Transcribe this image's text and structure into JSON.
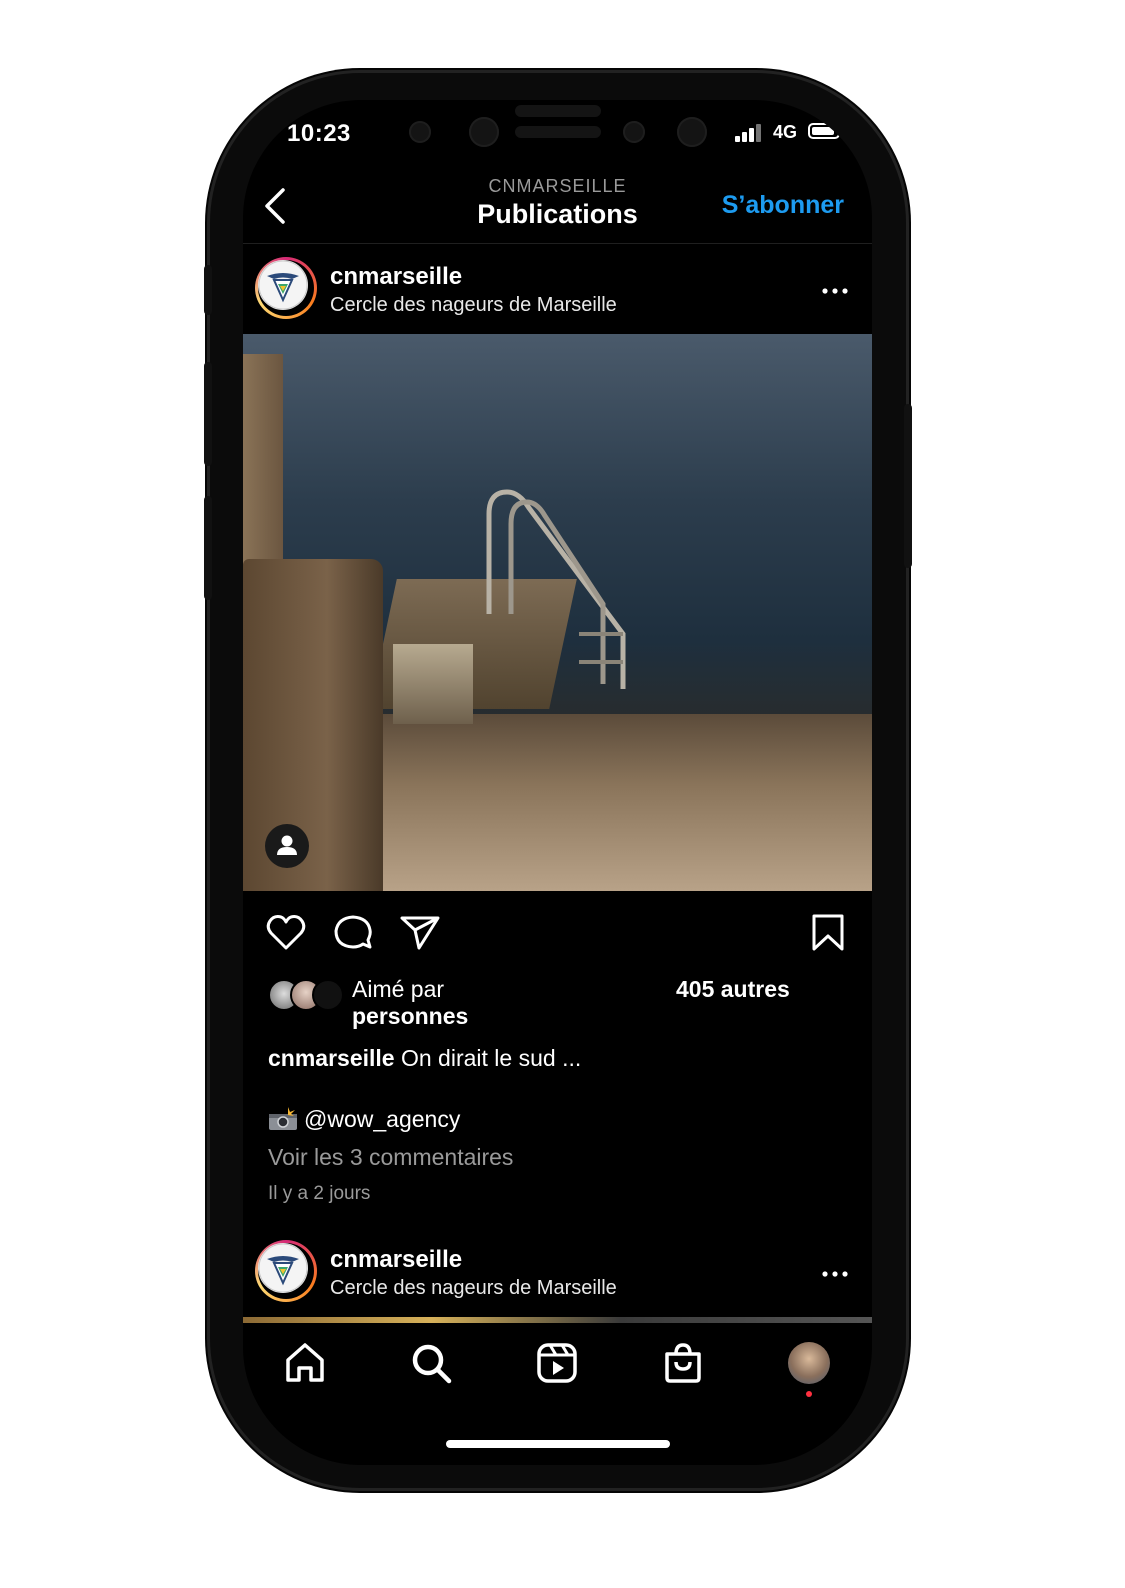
{
  "status_bar": {
    "time": "10:23",
    "network": "4G"
  },
  "header": {
    "account": "CNMARSEILLE",
    "title": "Publications",
    "follow_label": "S’abonner"
  },
  "post": {
    "username": "cnmarseille",
    "location": "Cercle des nageurs de Marseille",
    "liked_by_prefix": "Aimé par",
    "liked_by_people": "personnes",
    "liked_others": "405 autres",
    "caption_user": "cnmarseille",
    "caption_text": "On dirait le sud ...",
    "credit": "@wow_agency",
    "view_comments": "Voir les 3 commentaires",
    "time_ago": "Il y a 2 jours"
  },
  "next_post": {
    "username": "cnmarseille",
    "location": "Cercle des nageurs de Marseille"
  },
  "colors": {
    "accent": "#1d9bf0",
    "background": "#000000",
    "notification_dot": "#ff3040"
  },
  "bottom_nav": [
    "home-icon",
    "search-icon",
    "reels-icon",
    "shop-icon",
    "profile-avatar"
  ]
}
